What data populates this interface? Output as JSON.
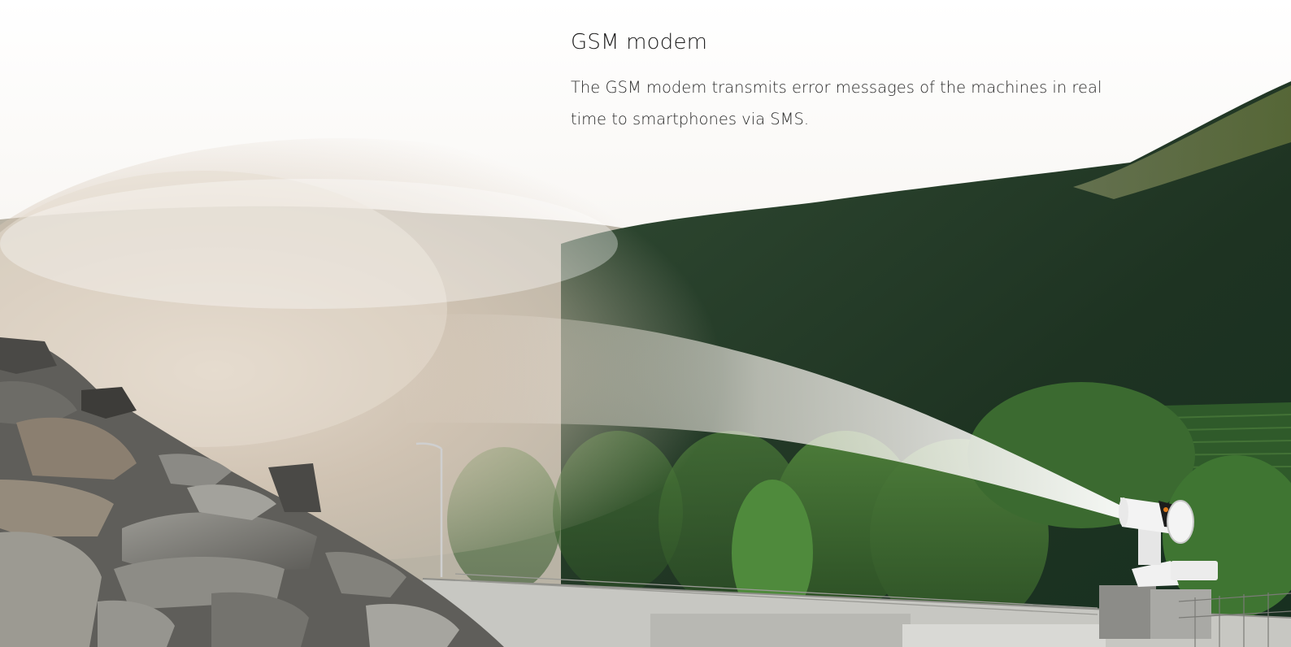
{
  "caption": {
    "title": "GSM modem",
    "body": "The GSM modem transmits error messages of the machines in real time to smartphones via SMS."
  },
  "scene": {
    "description_icons": [
      "mountain-forest",
      "dust-cannon-icon",
      "rock-pile",
      "bridge",
      "mist-spray"
    ],
    "colors": {
      "sky": "#f7f5f2",
      "forest_dark": "#1f3524",
      "forest_mid": "#2f4d30",
      "forest_light": "#4f7a3f",
      "mist": "#d9cfc3",
      "rocks": "#7a7a76",
      "cannon": "#e9e9e9"
    }
  }
}
